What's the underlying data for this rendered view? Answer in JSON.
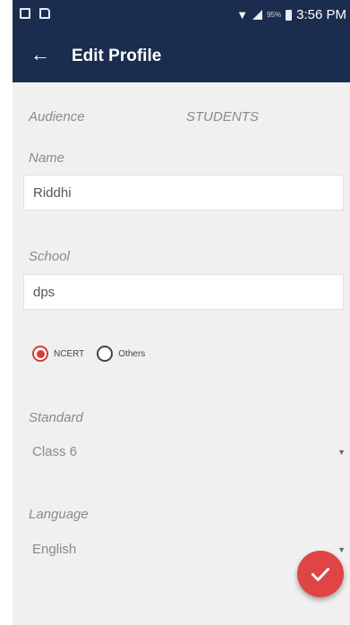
{
  "status_bar": {
    "battery_percent": "95%",
    "time": "3:56 PM",
    "icons": [
      "gallery-icon",
      "document-icon",
      "wifi-icon",
      "signal-icon",
      "battery-icon"
    ]
  },
  "app_bar": {
    "back_icon": "arrow-left-icon",
    "title": "Edit Profile",
    "color": "#1b2d4f"
  },
  "form": {
    "audience": {
      "label": "Audience",
      "value": "STUDENTS"
    },
    "name": {
      "label": "Name",
      "value": "Riddhi"
    },
    "school": {
      "label": "School",
      "value": "dps"
    },
    "board": {
      "options": [
        "NCERT",
        "Others"
      ],
      "selected": "NCERT",
      "accent": "#d43d3d"
    },
    "standard": {
      "label": "Standard",
      "value": "Class 6"
    },
    "language": {
      "label": "Language",
      "value": "English"
    }
  },
  "fab": {
    "icon": "checkmark-icon",
    "color": "#e04545"
  }
}
